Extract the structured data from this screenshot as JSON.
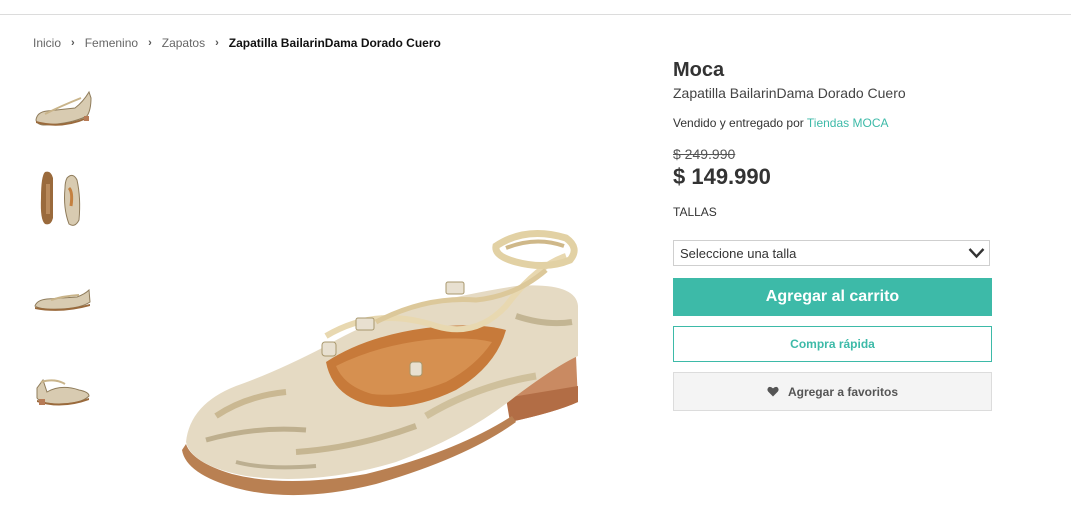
{
  "breadcrumb": {
    "items": [
      "Inicio",
      "Femenino",
      "Zapatos"
    ],
    "current": "Zapatilla BailarinDama Dorado Cuero",
    "separator_icon": "chevron-right-icon"
  },
  "gallery": {
    "thumbnails": [
      {
        "view": "side view"
      },
      {
        "view": "sole and top view"
      },
      {
        "view": "side view flat"
      },
      {
        "view": "rear view"
      }
    ]
  },
  "product": {
    "brand": "Moca",
    "name": "Zapatilla BailarinDama Dorado Cuero",
    "seller_prefix": "Vendido y entregado por",
    "seller_name": "Tiendas MOCA",
    "old_price": "$ 249.990",
    "price": "$ 149.990"
  },
  "sizes": {
    "label": "TALLAS",
    "select_placeholder": "Seleccione una talla"
  },
  "actions": {
    "add_to_cart": "Agregar al carrito",
    "quick_buy": "Compra rápida",
    "add_to_favorites": "Agregar a favoritos",
    "favorites_icon": "heart-icon"
  },
  "colors": {
    "accent": "#3dbaa8",
    "text": "#333333",
    "fav_bg": "#f4f4f4"
  }
}
